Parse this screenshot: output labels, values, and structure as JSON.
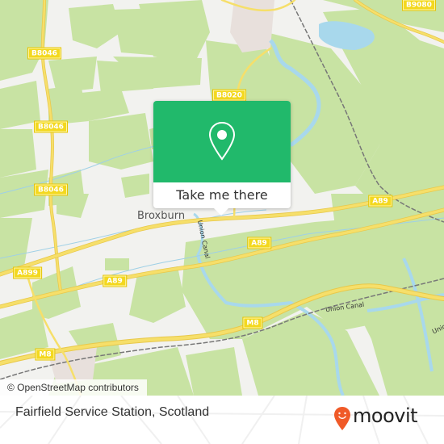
{
  "map": {
    "road_labels": [
      {
        "id": "b8046-1",
        "text": "B8046"
      },
      {
        "id": "b8046-2",
        "text": "B8046"
      },
      {
        "id": "b8046-3",
        "text": "B8046"
      },
      {
        "id": "b8020",
        "text": "B8020"
      },
      {
        "id": "b9080",
        "text": "B9080"
      },
      {
        "id": "a89-east",
        "text": "A89"
      },
      {
        "id": "a89-mid",
        "text": "A89"
      },
      {
        "id": "a89-west",
        "text": "A89"
      },
      {
        "id": "a899",
        "text": "A899"
      },
      {
        "id": "m8-west",
        "text": "M8"
      },
      {
        "id": "m8-mid",
        "text": "M8"
      }
    ],
    "place_labels": {
      "broxburn": "Broxburn"
    },
    "water_labels": {
      "union_canal_1": "Union Canal",
      "union_canal_2": "Union Canal",
      "union_canal_3": "Unio"
    },
    "colors": {
      "land": "#f2f2ef",
      "field": "#c8e3a3",
      "water": "#a8d8ec",
      "road_major": "#f6df6a",
      "urban": "#e8e0dc",
      "rail": "#777777"
    }
  },
  "popup": {
    "icon": "map-pin-icon",
    "action_label": "Take me there",
    "accent_color": "#21b96b"
  },
  "attribution": "© OpenStreetMap contributors",
  "footer": {
    "location_title": "Fairfield Service Station, Scotland",
    "brand": "moovit",
    "brand_color": "#f05a28"
  }
}
